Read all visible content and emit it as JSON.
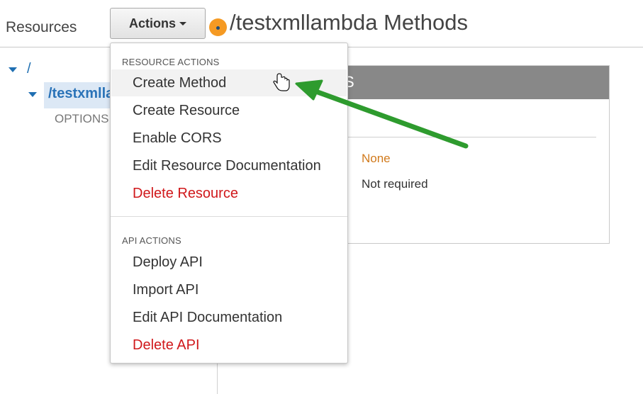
{
  "sidebar": {
    "title": "Resources",
    "root_label": "/",
    "selected_resource": "/testxmllambda",
    "method_label": "OPTIONS"
  },
  "header": {
    "actions_label": "Actions",
    "page_title": "/testxmllambda Methods"
  },
  "menu": {
    "resource_actions_heading": "RESOURCE ACTIONS",
    "resource_actions": [
      {
        "label": "Create Method"
      },
      {
        "label": "Create Resource"
      },
      {
        "label": "Enable CORS"
      },
      {
        "label": "Edit Resource Documentation"
      },
      {
        "label": "Delete Resource"
      }
    ],
    "api_actions_heading": "API ACTIONS",
    "api_actions": [
      {
        "label": "Deploy API"
      },
      {
        "label": "Import API"
      },
      {
        "label": "Edit API Documentation"
      },
      {
        "label": "Delete API"
      }
    ]
  },
  "panel": {
    "header_fragment": "S",
    "colon_fragment": ":",
    "authorization_value": "None",
    "api_key_value": "Not required"
  },
  "colors": {
    "accent_blue": "#1f6fb2",
    "danger_red": "#d0181b",
    "warning_orange": "#d17a1c",
    "annotation_green": "#2e9b2e",
    "status_dot": "#f59a23"
  },
  "icons": {
    "expand_root": "triangle-down-icon",
    "expand_resource": "triangle-down-icon",
    "actions_caret": "caret-down-icon",
    "status_dot": "status-dot-icon",
    "pointer": "hand-cursor-icon",
    "annotation": "arrow-annotation-icon"
  }
}
